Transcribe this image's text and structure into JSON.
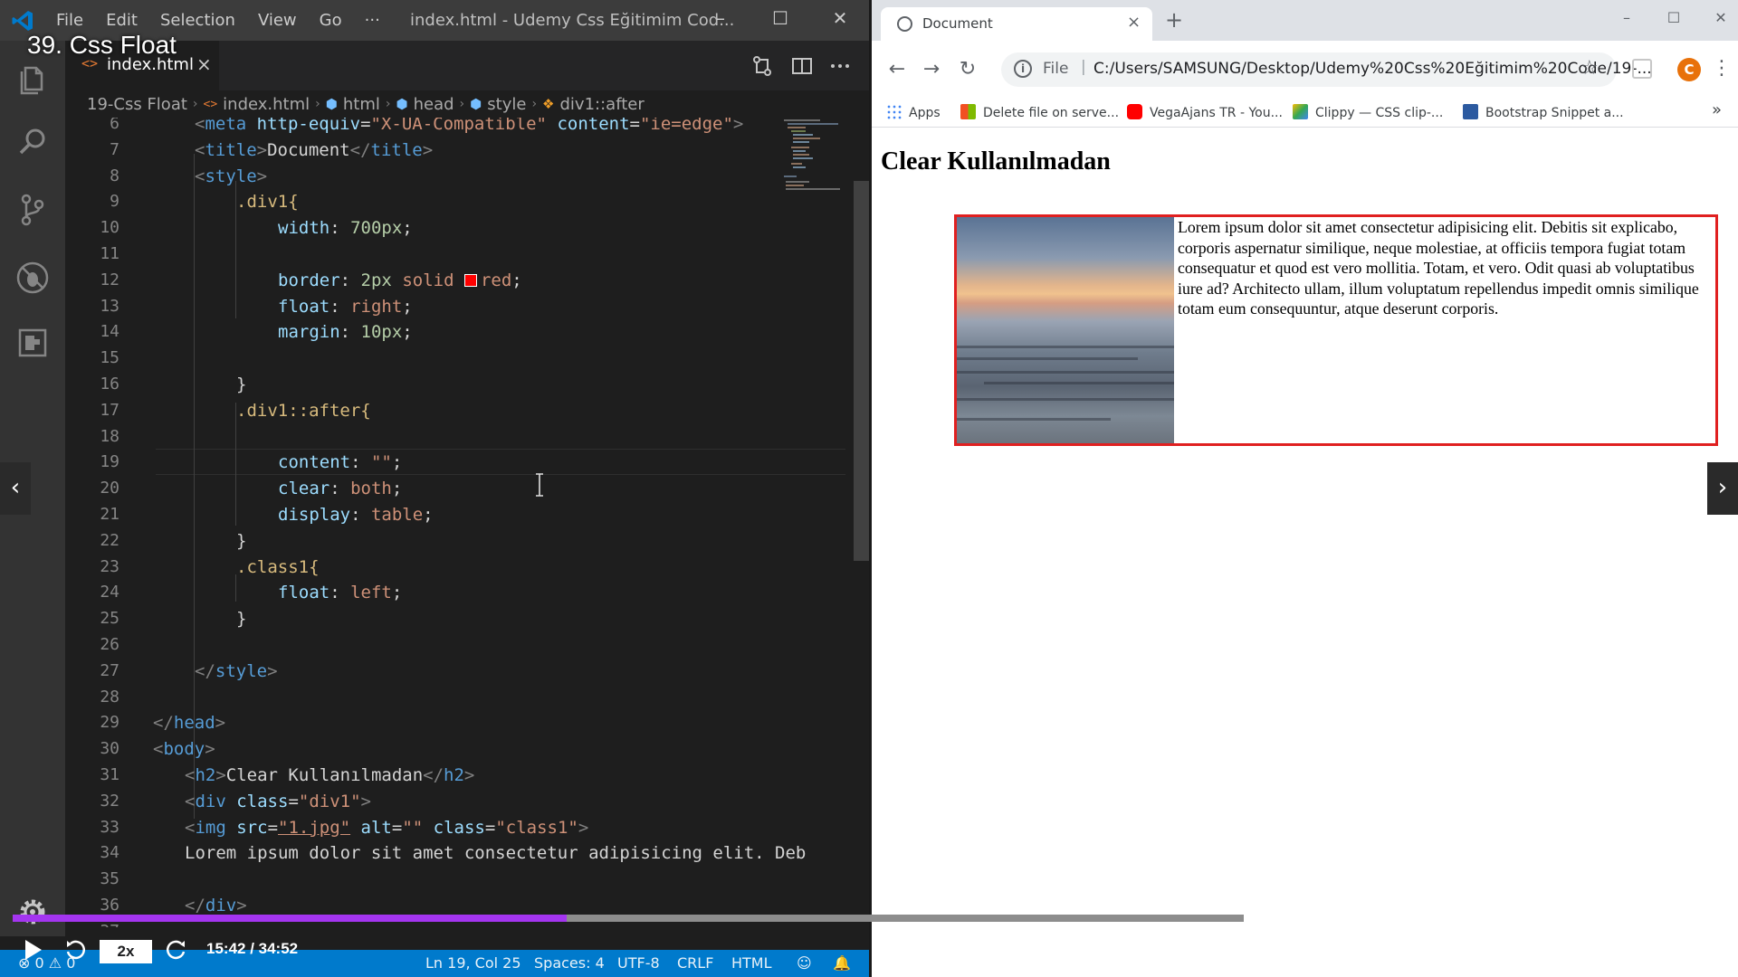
{
  "vscode": {
    "menu": [
      "File",
      "Edit",
      "Selection",
      "View",
      "Go",
      "···"
    ],
    "window_title": "index.html - Udemy Css Eğitimim Cod...",
    "tab": {
      "icon": "<>",
      "name": "index.html",
      "close": "×"
    },
    "breadcrumb": [
      "19-Css Float",
      "index.html",
      "html",
      "head",
      "style",
      "div1::after"
    ],
    "line_numbers": [
      "6",
      "7",
      "8",
      "9",
      "10",
      "11",
      "12",
      "13",
      "14",
      "15",
      "16",
      "17",
      "18",
      "19",
      "20",
      "21",
      "22",
      "23",
      "24",
      "25",
      "26",
      "27",
      "28",
      "29",
      "30",
      "31",
      "32",
      "33",
      "34",
      "35",
      "36",
      "37"
    ],
    "code": {
      "l6": {
        "tag": "meta",
        "a1": "http-equiv",
        "v1": "\"X-UA-Compatible\"",
        "a2": "content",
        "v2": "\"ie=edge\""
      },
      "l7": {
        "open": "title",
        "text": "Document",
        "close": "title"
      },
      "l8": {
        "open": "style"
      },
      "l9": ".div1{",
      "l10": {
        "prop": "width",
        "val": "700px"
      },
      "l12": {
        "prop": "border",
        "v1": "2px",
        "v2": "solid",
        "v3": "red"
      },
      "l13": {
        "prop": "float",
        "val": "right"
      },
      "l14": {
        "prop": "margin",
        "val": "10px"
      },
      "l16": "}",
      "l17": ".div1::after{",
      "l19": {
        "prop": "content",
        "val": "\"\""
      },
      "l20": {
        "prop": "clear",
        "val": "both"
      },
      "l21": {
        "prop": "display",
        "val": "table"
      },
      "l22": "}",
      "l23": ".class1{",
      "l24": {
        "prop": "float",
        "val": "left"
      },
      "l25": "}",
      "l27": {
        "close": "style"
      },
      "l29": {
        "close": "head"
      },
      "l30": {
        "open": "body"
      },
      "l31": {
        "open": "h2",
        "text": "Clear Kullanılmadan",
        "close": "h2"
      },
      "l32": {
        "tag": "div",
        "a1": "class",
        "v1": "\"div1\""
      },
      "l33": {
        "tag": "img",
        "a1": "src",
        "v1": "\"1.jpg\"",
        "a2": "alt",
        "v2": "\"\"",
        "a3": "class",
        "v3": "\"class1\""
      },
      "l34": "Lorem ipsum dolor sit amet consectetur adipisicing elit. Deb",
      "l36": {
        "close": "div"
      }
    },
    "status": {
      "errors": "0",
      "warnings": "0",
      "position": "Ln 19, Col 25",
      "spaces": "Spaces: 4",
      "encoding": "UTF-8",
      "eol": "CRLF",
      "language": "HTML"
    }
  },
  "browser": {
    "tab_title": "Document",
    "tab_close": "×",
    "new_tab": "+",
    "scheme": "File",
    "url": "C:/Users/SAMSUNG/Desktop/Udemy%20Css%20Eğitimim%20Code/19-...",
    "avatar_letter": "C",
    "bookmarks": [
      {
        "label": "Apps",
        "color": "#4285f4"
      },
      {
        "label": "Delete file on serve...",
        "color": "#f25022"
      },
      {
        "label": "VegaAjans TR - You...",
        "color": "#ff0000"
      },
      {
        "label": "Clippy — CSS clip-...",
        "color": "#34a853"
      },
      {
        "label": "Bootstrap Snippet a...",
        "color": "#2c5aa0"
      }
    ],
    "bookmarks_more": "»",
    "page": {
      "heading": "Clear Kullanılmadan",
      "paragraph": "Lorem ipsum dolor sit amet consectetur adipisicing elit. Debitis sit explicabo, corporis aspernatur similique, neque molestiae, at officiis tempora fugiat totam consequatur et quod est vero mollitia. Totam, et vero. Odit quasi ab voluptatibus iure ad? Architecto ullam, illum voluptatum repellendus impedit omnis similique totam eum consequuntur, atque deserunt corporis."
    }
  },
  "player": {
    "lecture_title": "39. Css Float",
    "speed": "2x",
    "timecode": "15:42 / 34:52",
    "progress_fraction": 0.45,
    "accent": "#a435f0"
  }
}
